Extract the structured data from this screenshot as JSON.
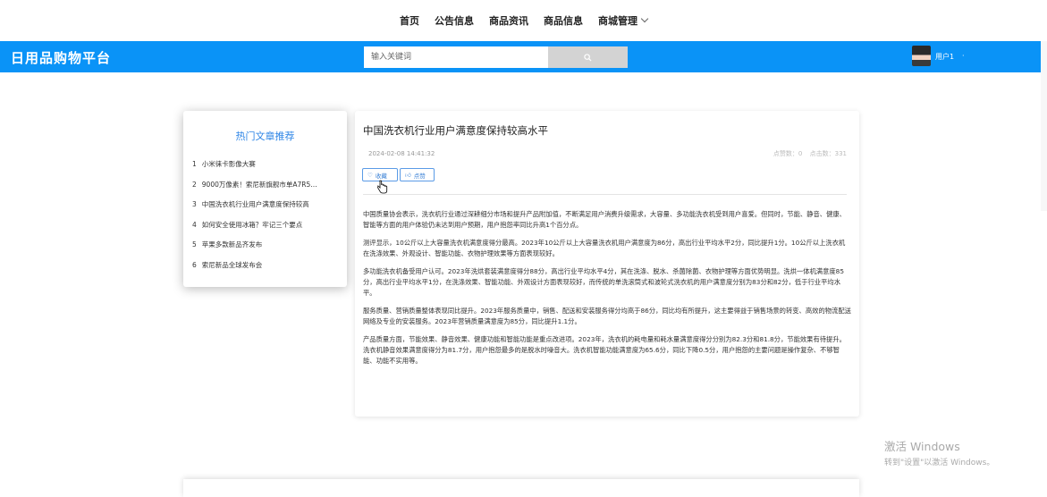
{
  "nav": {
    "items": [
      "首页",
      "公告信息",
      "商品资讯",
      "商品信息"
    ],
    "manage": "商城管理"
  },
  "header": {
    "logo": "日用品购物平台",
    "search_placeholder": "输入关键词",
    "username": "用户1",
    "user_caret": "·"
  },
  "sidebar": {
    "title": "热门文章推荐",
    "items": [
      {
        "num": "1",
        "label": "小米徕卡影像大赛"
      },
      {
        "num": "2",
        "label": "9000万像素！索尼新旗舰市单A7R5…"
      },
      {
        "num": "3",
        "label": "中国洗衣机行业用户满意度保持较高"
      },
      {
        "num": "4",
        "label": "如何安全使用冰箱？牢记三个要点"
      },
      {
        "num": "5",
        "label": "苹果多款新品齐发布"
      },
      {
        "num": "6",
        "label": "索尼新品全球发布会"
      }
    ]
  },
  "article": {
    "title": "中国洗衣机行业用户满意度保持较高水平",
    "date": "2024-02-08 14:41:32",
    "likes": "点赞数：0",
    "clicks": "点击数：331",
    "fav_label": "收藏",
    "like_label": "点赞",
    "paragraphs": [
      "中国质量协会表示，洗衣机行业通过深耕细分市场和提升产品附加值，不断满足用户消费升级需求，大容量、多功能洗衣机受到用户喜爱。但同时，节能、静音、健康、智能等方面的用户体验仍未达到用户预期，用户抱怨率同比升高1个百分点。",
      "测评显示，10公斤以上大容量洗衣机满意度得分最高。2023年10公斤以上大容量洗衣机用户满意度为86分，高出行业平均水平2分，同比提升1分。10公斤以上洗衣机在洗涤效果、外观设计、智能功能、衣物护理效果等方面表现较好。",
      "多功能洗衣机备受用户认可。2023年洗烘套装满意度得分88分，高出行业平均水平4分，其在洗涤、脱水、杀菌除菌、衣物护理等方面优势明显。洗烘一体机满意度85分，高出行业平均水平1分，在洗涤效果、智能功能、外观设计方面表现较好，而传统的单洗滚筒式和波轮式洗衣机的用户满意度分别为83分和82分，低于行业平均水平。",
      "服务质量、营销质量整体表现同比提升。2023年服务质量中，销售、配送和安装服务得分均高于86分，同比均有所提升，这主要得益于销售场景的转变、高效的物流配送网络及专业的安装服务。2023年营销质量满意度为85分，同比提升1.1分。",
      "产品质量方面，节能效果、静音效果、健康功能和智能功能是重点改进项。2023年，洗衣机的耗电量和耗水量满意度得分分别为82.3分和81.8分，节能效果有待提升。洗衣机静音效果满意度得分为81.7分，用户抱怨最多的是脱水时噪音大。洗衣机智能功能满意度为65.6分，同比下降0.5分，用户抱怨的主要问题是操作复杂、不够智能、功能不实用等。"
    ]
  },
  "watermark": {
    "line1": "激活 Windows",
    "line2": "转到\"设置\"以激活 Windows。"
  }
}
